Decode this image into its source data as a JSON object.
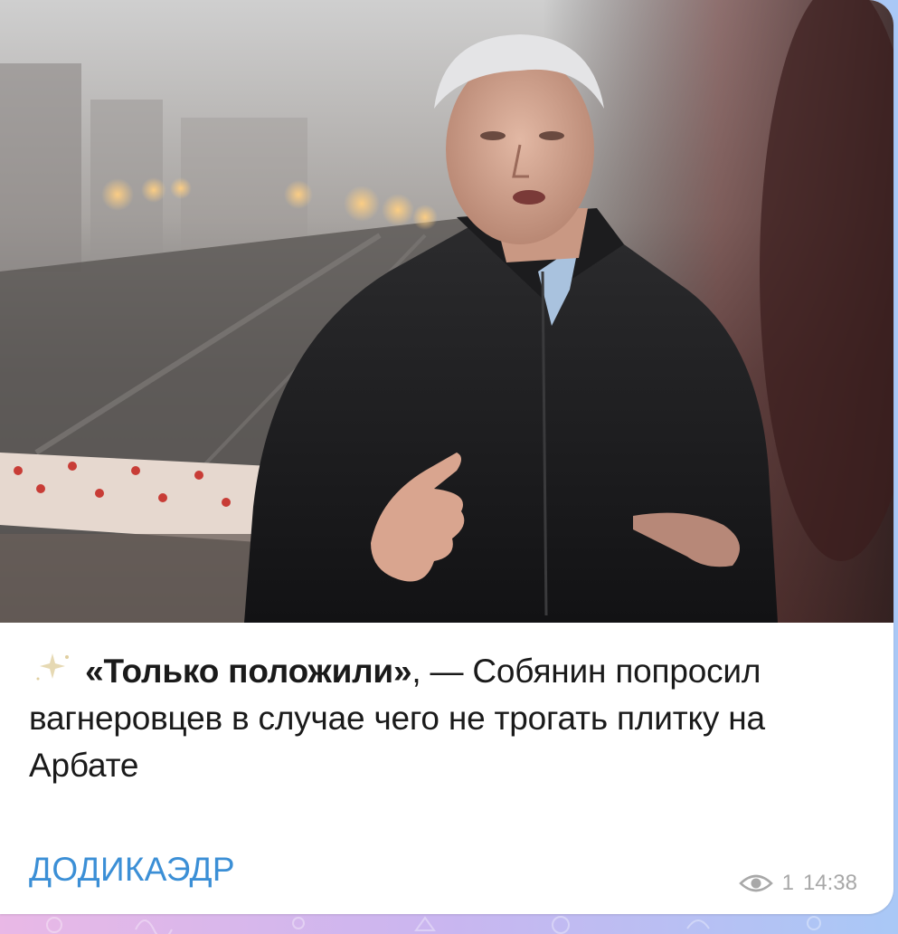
{
  "post": {
    "caption_quote": "«Только положили»",
    "caption_rest": ", — Собянин попросил вагнеровцев в случае чего не трогать плитку на Арбате",
    "author": "ДОДИКАЭДР",
    "views": "1",
    "time": "14:38"
  },
  "icons": {
    "lead": "sparkle-icon",
    "views": "eye-icon"
  },
  "colors": {
    "author": "#3b8fd6",
    "meta": "#a8a8a8"
  }
}
